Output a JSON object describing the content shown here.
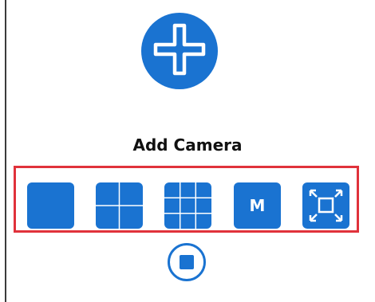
{
  "panel": {
    "add_camera": {
      "label": "Add Camera",
      "icon": "plus-icon"
    },
    "layout_toolbar": {
      "buttons": [
        {
          "name": "layout-1",
          "icon": "single-view-icon"
        },
        {
          "name": "layout-4",
          "icon": "grid-2x2-icon"
        },
        {
          "name": "layout-9",
          "icon": "grid-3x3-icon"
        },
        {
          "name": "multi-view",
          "label": "M"
        },
        {
          "name": "fullscreen",
          "icon": "fullscreen-icon"
        }
      ]
    },
    "stop": {
      "icon": "stop-icon"
    }
  },
  "colors": {
    "accent": "#1a73d1",
    "highlight_border": "#e0323b",
    "text": "#111111"
  }
}
